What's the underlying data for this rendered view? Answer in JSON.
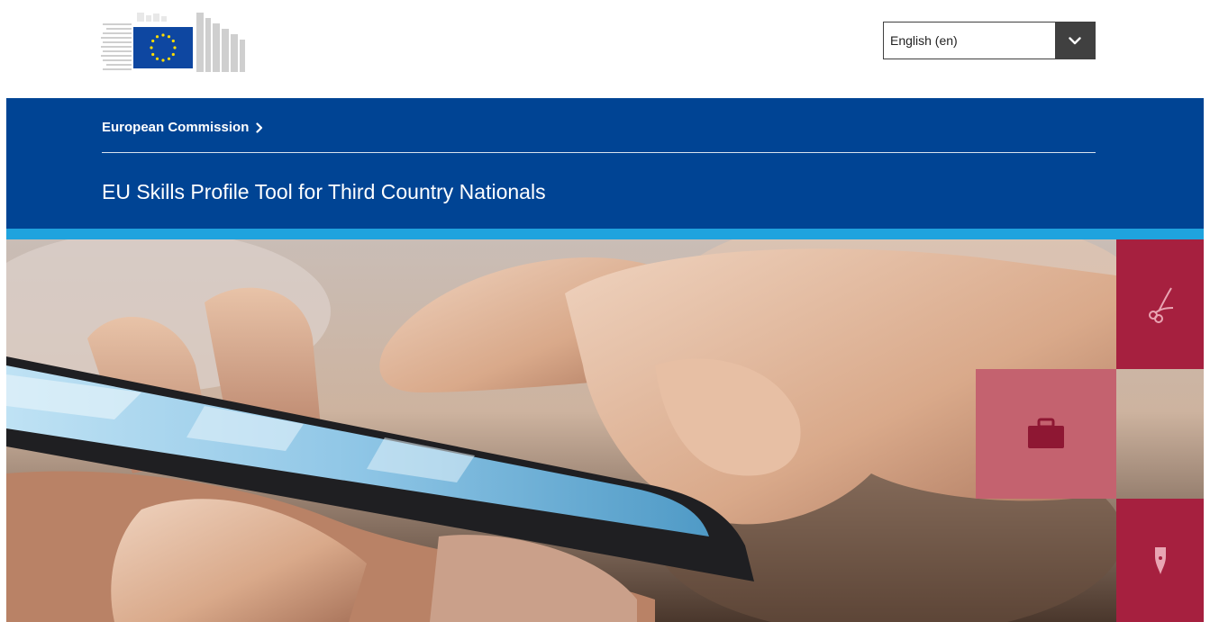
{
  "header": {
    "logo_icon": "eu-flag-logo",
    "language_selector": {
      "value": "English (en)",
      "toggle_icon": "chevron-down-icon"
    }
  },
  "banner": {
    "breadcrumb": "European Commission",
    "breadcrumb_icon": "chevron-right-icon",
    "site_title": "EU Skills Profile Tool for Third Country Nationals"
  },
  "hero": {
    "image": "hands-using-smartphone-photo",
    "tiles": [
      {
        "icon": "scissors-icon"
      },
      {
        "icon": "briefcase-icon"
      },
      {
        "icon": "fountain-pen-icon"
      }
    ]
  },
  "colors": {
    "banner_blue": "#004494",
    "accent_blue": "#1fa3de",
    "tile_dark": "#a6203f",
    "tile_light": "#c4626f",
    "select_dark": "#404040"
  }
}
